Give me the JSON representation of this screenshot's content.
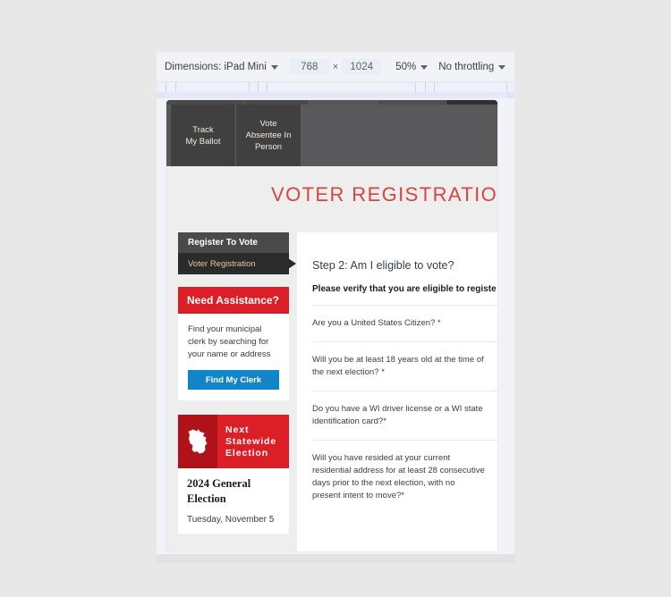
{
  "devtools": {
    "dimensions_label": "Dimensions: iPad Mini",
    "width_value": "768",
    "times_symbol": "×",
    "height_value": "1024",
    "zoom_value": "50%",
    "throttling_label": "No throttling"
  },
  "site": {
    "title": "VOTER REGISTRATION",
    "nav_tabs": [
      {
        "label": "Track\nMy Ballot"
      },
      {
        "label": "Vote\nAbsentee In\nPerson"
      }
    ]
  },
  "sidebar": {
    "section_header": "Register To Vote",
    "active_item": "Voter Registration",
    "assistance": {
      "heading": "Need Assistance?",
      "body": "Find your municipal clerk by searching for your name or address",
      "button_label": "Find My Clerk"
    },
    "election": {
      "heading": "Next\nStatewide\nElection",
      "name": "2024 General Election",
      "date": "Tuesday, November 5"
    }
  },
  "main": {
    "step_title": "Step 2: Am I eligible to vote?",
    "instruction": "Please verify that you are eligible to registe",
    "questions": [
      "Are you a United States Citizen? *",
      "Will you be at least 18 years old at the time of the next election? *",
      "Do you have a WI driver license or a WI state identification card?*",
      "Will you have resided at your current residential address for at least 28 consecutive days prior to the next election, with no present intent to move?*"
    ]
  },
  "colors": {
    "brand_red": "#dc1f26",
    "title_red": "#d6453f",
    "button_blue": "#1285c9",
    "nav_dark": "#404040"
  }
}
